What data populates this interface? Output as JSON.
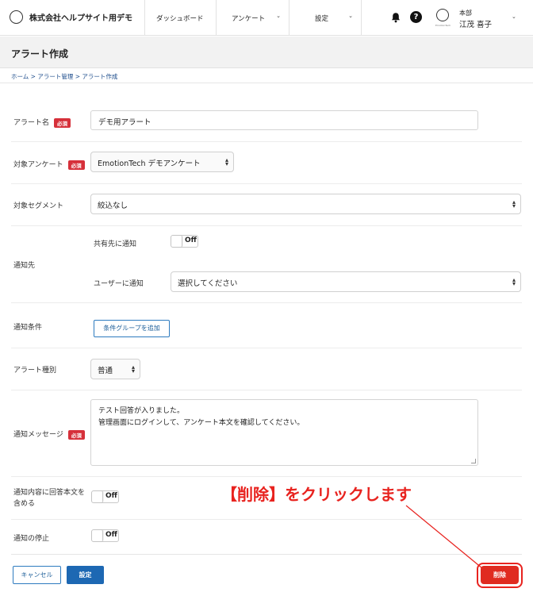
{
  "header": {
    "company": "株式会社ヘルプサイト用デモ",
    "nav": [
      {
        "label": "ダッシュボード"
      },
      {
        "label": "アンケート"
      },
      {
        "label": "設定"
      }
    ],
    "user": {
      "dept": "本部",
      "name": "江茂 喜子",
      "avatar_caption": "EmotionTech"
    }
  },
  "page": {
    "title": "アラート作成",
    "breadcrumb": "ホーム > アラート管理 > アラート作成"
  },
  "form": {
    "required_badge": "必須",
    "alert_name": {
      "label": "アラート名",
      "value": "デモ用アラート"
    },
    "survey": {
      "label": "対象アンケート",
      "value": "EmotionTech デモアンケート"
    },
    "segment": {
      "label": "対象セグメント",
      "value": "絞込なし"
    },
    "notify_to": {
      "label": "通知先",
      "share_label": "共有先に通知",
      "share_toggle": "Off",
      "user_label": "ユーザーに通知",
      "user_value": "選択してください"
    },
    "condition": {
      "label": "通知条件",
      "button": "条件グループを追加"
    },
    "alert_type": {
      "label": "アラート種別",
      "value": "普通"
    },
    "message": {
      "label": "通知メッセージ",
      "line1": "テスト回答が入りました。",
      "line2": "管理画面にログインして、アンケート本文を確認してください。"
    },
    "include_body": {
      "label_line1": "通知内容に回答本文を",
      "label_line2": "含める",
      "toggle": "Off"
    },
    "stop": {
      "label": "通知の停止",
      "toggle": "Off"
    }
  },
  "actions": {
    "cancel": "キャンセル",
    "save": "設定",
    "delete": "削除"
  },
  "annotation": {
    "text": "【削除】をクリックします",
    "color": "#e8231f"
  },
  "colors": {
    "primary": "#1d68b3",
    "danger": "#e02b20",
    "required": "#d6303a"
  }
}
